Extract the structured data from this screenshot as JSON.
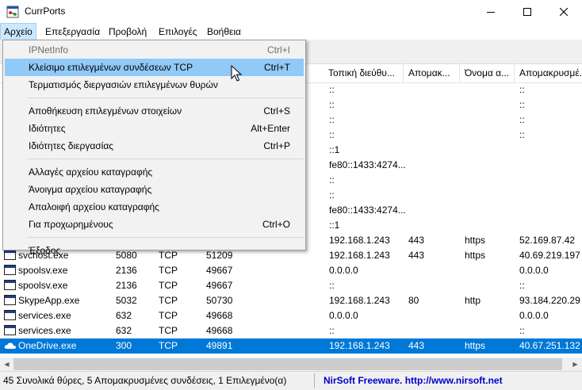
{
  "window": {
    "title": "CurrPorts",
    "controls": {
      "minimize": "–",
      "maximize": "☐",
      "close": "✕"
    }
  },
  "menubar": [
    {
      "label": "Αρχείο",
      "active": true
    },
    {
      "label": "Επεξεργασία"
    },
    {
      "label": "Προβολή"
    },
    {
      "label": "Επιλογές"
    },
    {
      "label": "Βοήθεια"
    }
  ],
  "columns": [
    "Τοπική διεύθυ...",
    "Απομακ...",
    "Όνομα α...",
    "Απομακρυσμέ..."
  ],
  "rows": [
    {
      "process": "",
      "pid": "",
      "protocol": "",
      "local_port": "",
      "local_address": "::",
      "remote_port": "",
      "remote_port_name": "",
      "remote_address": "::"
    },
    {
      "process": "",
      "pid": "",
      "protocol": "",
      "local_port": "",
      "local_address": "::",
      "remote_port": "",
      "remote_port_name": "",
      "remote_address": "::"
    },
    {
      "process": "",
      "pid": "",
      "protocol": "",
      "local_port": "",
      "local_address": "::",
      "remote_port": "",
      "remote_port_name": "",
      "remote_address": "::"
    },
    {
      "process": "",
      "pid": "",
      "protocol": "",
      "local_port": "",
      "local_address": "::",
      "remote_port": "",
      "remote_port_name": "",
      "remote_address": "::"
    },
    {
      "process": "",
      "pid": "",
      "protocol": "",
      "local_port": "",
      "local_address": "::1",
      "remote_port": "",
      "remote_port_name": "",
      "remote_address": ""
    },
    {
      "process": "",
      "pid": "",
      "protocol": "",
      "local_port": "",
      "local_address": "fe80::1433:4274...",
      "remote_port": "",
      "remote_port_name": "",
      "remote_address": ""
    },
    {
      "process": "",
      "pid": "",
      "protocol": "",
      "local_port": "",
      "local_address": "::",
      "remote_port": "",
      "remote_port_name": "",
      "remote_address": ""
    },
    {
      "process": "",
      "pid": "",
      "protocol": "",
      "local_port": "",
      "local_address": "::",
      "remote_port": "",
      "remote_port_name": "",
      "remote_address": ""
    },
    {
      "process": "",
      "pid": "",
      "protocol": "",
      "local_port": "",
      "local_address": "fe80::1433:4274...",
      "remote_port": "",
      "remote_port_name": "",
      "remote_address": ""
    },
    {
      "process": "",
      "pid": "",
      "protocol": "",
      "local_port": "",
      "local_address": "::1",
      "remote_port": "",
      "remote_port_name": "",
      "remote_address": ""
    },
    {
      "process": "",
      "pid": "",
      "protocol": "",
      "local_port": "",
      "local_address": "192.168.1.243",
      "remote_port": "443",
      "remote_port_name": "https",
      "remote_address": "52.169.87.42"
    },
    {
      "process": "svchost.exe",
      "pid": "5080",
      "protocol": "TCP",
      "local_port": "51209",
      "local_address": "192.168.1.243",
      "remote_port": "443",
      "remote_port_name": "https",
      "remote_address": "40.69.219.197"
    },
    {
      "process": "spoolsv.exe",
      "pid": "2136",
      "protocol": "TCP",
      "local_port": "49667",
      "local_address": "0.0.0.0",
      "remote_port": "",
      "remote_port_name": "",
      "remote_address": "0.0.0.0"
    },
    {
      "process": "spoolsv.exe",
      "pid": "2136",
      "protocol": "TCP",
      "local_port": "49667",
      "local_address": "::",
      "remote_port": "",
      "remote_port_name": "",
      "remote_address": "::"
    },
    {
      "process": "SkypeApp.exe",
      "pid": "5032",
      "protocol": "TCP",
      "local_port": "50730",
      "local_address": "192.168.1.243",
      "remote_port": "80",
      "remote_port_name": "http",
      "remote_address": "93.184.220.29"
    },
    {
      "process": "services.exe",
      "pid": "632",
      "protocol": "TCP",
      "local_port": "49668",
      "local_address": "0.0.0.0",
      "remote_port": "",
      "remote_port_name": "",
      "remote_address": "0.0.0.0"
    },
    {
      "process": "services.exe",
      "pid": "632",
      "protocol": "TCP",
      "local_port": "49668",
      "local_address": "::",
      "remote_port": "",
      "remote_port_name": "",
      "remote_address": "::"
    },
    {
      "process": "OneDrive.exe",
      "pid": "300",
      "protocol": "TCP",
      "local_port": "49891",
      "local_address": "192.168.1.243",
      "remote_port": "443",
      "remote_port_name": "https",
      "remote_address": "40.67.251.132",
      "selected": true,
      "icon": "cloud"
    }
  ],
  "file_menu": {
    "items": [
      {
        "label": "IPNetInfo",
        "shortcut": "Ctrl+I",
        "disabled": true
      },
      {
        "label": "Κλείσιμο επιλεγμένων συνδέσεων TCP",
        "shortcut": "Ctrl+T",
        "hot": true
      },
      {
        "label": "Τερματισμός διεργασιών επιλεγμένων θυρών",
        "shortcut": ""
      },
      {
        "separator": true
      },
      {
        "label": "Αποθήκευση επιλεγμένων στοιχείων",
        "shortcut": "Ctrl+S"
      },
      {
        "label": "Ιδιότητες",
        "shortcut": "Alt+Enter"
      },
      {
        "label": "Ιδιότητες διεργασίας",
        "shortcut": "Ctrl+P"
      },
      {
        "separator": true
      },
      {
        "label": "Αλλαγές αρχείου καταγραφής",
        "shortcut": ""
      },
      {
        "label": "Άνοιγμα αρχείου καταγραφής",
        "shortcut": ""
      },
      {
        "label": "Απαλοιφή αρχείου καταγραφής",
        "shortcut": ""
      },
      {
        "label": "Για προχωρημένους",
        "shortcut": "Ctrl+O"
      },
      {
        "separator": true
      },
      {
        "label": "Έξοδος",
        "shortcut": ""
      }
    ]
  },
  "statusbar": {
    "summary": "45 Συνολικά θύρες, 5 Απομακρυσμένες συνδέσεις, 1 Επιλεγμένο(α)",
    "link": "NirSoft Freeware.  http://www.nirsoft.net"
  },
  "colors": {
    "selection": "#0078d7",
    "menu_hot": "#91c9f7",
    "link": "#0000cc"
  }
}
